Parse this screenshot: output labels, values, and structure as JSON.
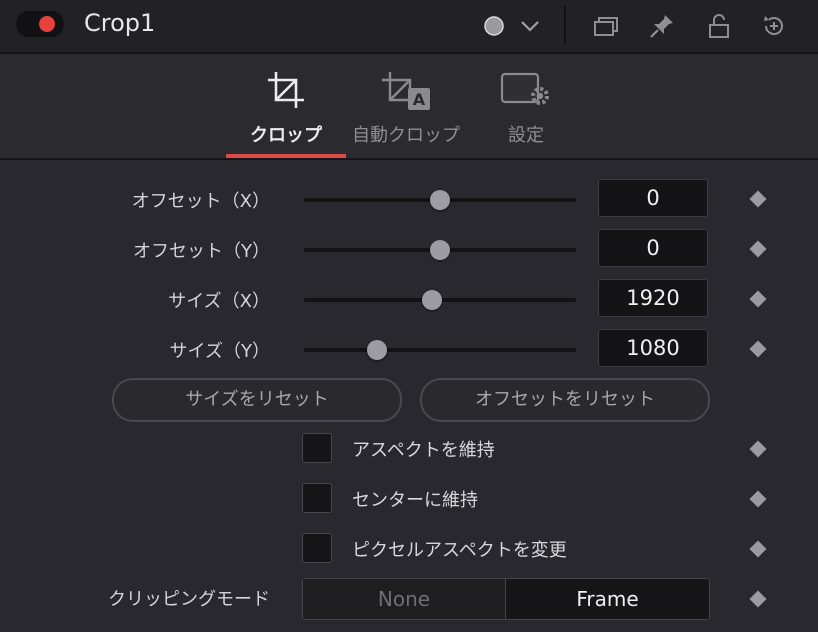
{
  "header": {
    "title": "Crop1",
    "toggle_color": "#e8413b"
  },
  "tabs": [
    {
      "label": "クロップ",
      "icon": "crop-icon",
      "active": true
    },
    {
      "label": "自動クロップ",
      "icon": "auto-crop-icon",
      "active": false
    },
    {
      "label": "設定",
      "icon": "settings-icon",
      "active": false
    }
  ],
  "params": [
    {
      "label": "オフセット（X）",
      "value": "0",
      "slider": 0.5
    },
    {
      "label": "オフセット（Y）",
      "value": "0",
      "slider": 0.5
    },
    {
      "label": "サイズ（X）",
      "value": "1920",
      "slider": 0.47
    },
    {
      "label": "サイズ（Y）",
      "value": "1080",
      "slider": 0.27
    }
  ],
  "buttons": {
    "reset_size": "サイズをリセット",
    "reset_offset": "オフセットをリセット"
  },
  "checkboxes": [
    {
      "label": "アスペクトを維持",
      "checked": false
    },
    {
      "label": "センターに維持",
      "checked": false
    },
    {
      "label": "ピクセルアスペクトを変更",
      "checked": false
    }
  ],
  "clipping": {
    "label": "クリッピングモード",
    "options": [
      "None",
      "Frame"
    ],
    "selected": "Frame"
  },
  "colors": {
    "accent": "#d94b47",
    "background": "#28282e"
  }
}
